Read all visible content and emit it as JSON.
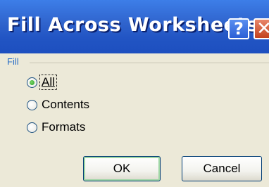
{
  "window": {
    "title": "Fill Across Worksheets",
    "help_glyph": "?",
    "close_glyph": "✕"
  },
  "group": {
    "label": "Fill"
  },
  "options": [
    {
      "label": "All",
      "checked": true
    },
    {
      "label": "Contents",
      "checked": false
    },
    {
      "label": "Formats",
      "checked": false
    }
  ],
  "buttons": {
    "ok_label": "OK",
    "cancel_label": "Cancel"
  },
  "colors": {
    "titlebar": "#2255c4",
    "group_label": "#2a6ec6",
    "close_button": "#c3421d",
    "radio_selected": "#21a121"
  },
  "icons": [
    "help-icon",
    "close-icon"
  ]
}
